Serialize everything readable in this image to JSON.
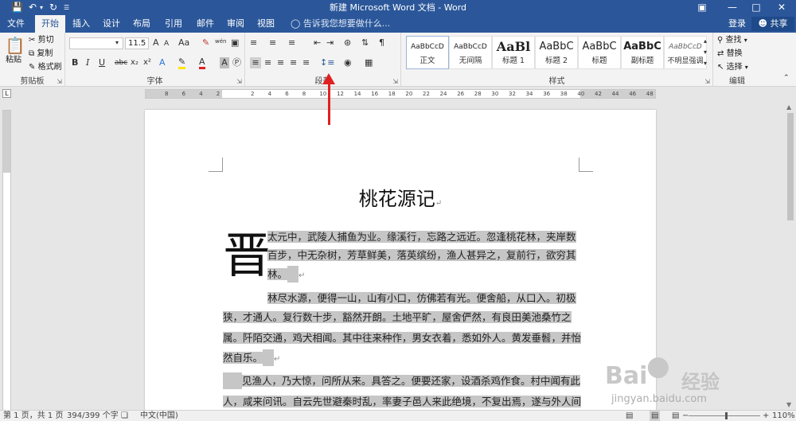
{
  "titlebar": {
    "title": "新建 Microsoft Word 文档 - Word",
    "save_icon": "save-icon",
    "undo_icon": "undo-icon",
    "redo_icon": "redo-icon"
  },
  "tabs": [
    "文件",
    "开始",
    "插入",
    "设计",
    "布局",
    "引用",
    "邮件",
    "审阅",
    "视图"
  ],
  "active_tab": "开始",
  "tellme": "告诉我您想要做什么...",
  "account": {
    "login": "登录",
    "share": "共享"
  },
  "ribbon": {
    "clipboard": {
      "paste": "粘贴",
      "cut": "剪切",
      "copy": "复制",
      "format_painter": "格式刷",
      "label": "剪贴板"
    },
    "font": {
      "name": "",
      "size": "11.5",
      "label": "字体",
      "bold": "B",
      "italic": "I",
      "underline": "U",
      "strike": "abc",
      "subscript": "x₂",
      "superscript": "x²",
      "case": "Aa",
      "grow": "A",
      "shrink": "A",
      "wen": "wén"
    },
    "paragraph": {
      "label": "段落"
    },
    "styles": {
      "label": "样式",
      "items": [
        {
          "preview": "AaBbCcD",
          "name": "正文"
        },
        {
          "preview": "AaBbCcD",
          "name": "无间隔"
        },
        {
          "preview": "AaBl",
          "name": "标题 1"
        },
        {
          "preview": "AaBbC",
          "name": "标题 2"
        },
        {
          "preview": "AaBbC",
          "name": "标题"
        },
        {
          "preview": "AaBbC",
          "name": "副标题"
        },
        {
          "preview": "AaBbCcD",
          "name": "不明显强调"
        }
      ]
    },
    "editing": {
      "find": "查找",
      "replace": "替换",
      "select": "选择",
      "label": "编辑"
    }
  },
  "ruler": {
    "marks": [
      "8",
      "6",
      "4",
      "2",
      "",
      "2",
      "4",
      "6",
      "8",
      "10",
      "12",
      "14",
      "16",
      "18",
      "20",
      "22",
      "24",
      "26",
      "28",
      "30",
      "32",
      "34",
      "36",
      "38",
      "40",
      "42",
      "44",
      "46",
      "48"
    ]
  },
  "document": {
    "title": "桃花源记",
    "dropcap": "晋",
    "lines": [
      "太元中，武陵人捕鱼为业。缘溪行，忘路之远近。忽逢桃花林，夹岸数",
      "百步，中无杂树，芳草鲜美，落英缤纷，渔人甚异之，复前行，欲穷其",
      "林。",
      "林尽水源，便得一山，山有小口，仿佛若有光。便舍船，从口入。初极",
      "狭，才通人。复行数十步，豁然开朗。土地平旷，屋舍俨然，有良田美池桑竹之",
      "属。阡陌交通，鸡犬相闻。其中往来种作，男女衣着，悉如外人。黄发垂髫，并怡",
      "然自乐。",
      "见渔人，乃大惊，问所从来。具答之。便要还家，设酒杀鸡作食。村中闻有此",
      "人，咸来问讯。自云先世避秦时乱，率妻子邑人来此绝境，不复出焉，遂与外人间"
    ]
  },
  "status": {
    "page": "第 1 页，共 1 页",
    "words": "394/399 个字",
    "lang": "中文(中国)",
    "zoom": "110%"
  },
  "watermark": {
    "brand": "Bai",
    "brand2": "经验",
    "url": "jingyan.baidu.com"
  },
  "colors": {
    "brand": "#2b579a",
    "arrow": "#e02020",
    "highlight": "#c6c6c6"
  }
}
